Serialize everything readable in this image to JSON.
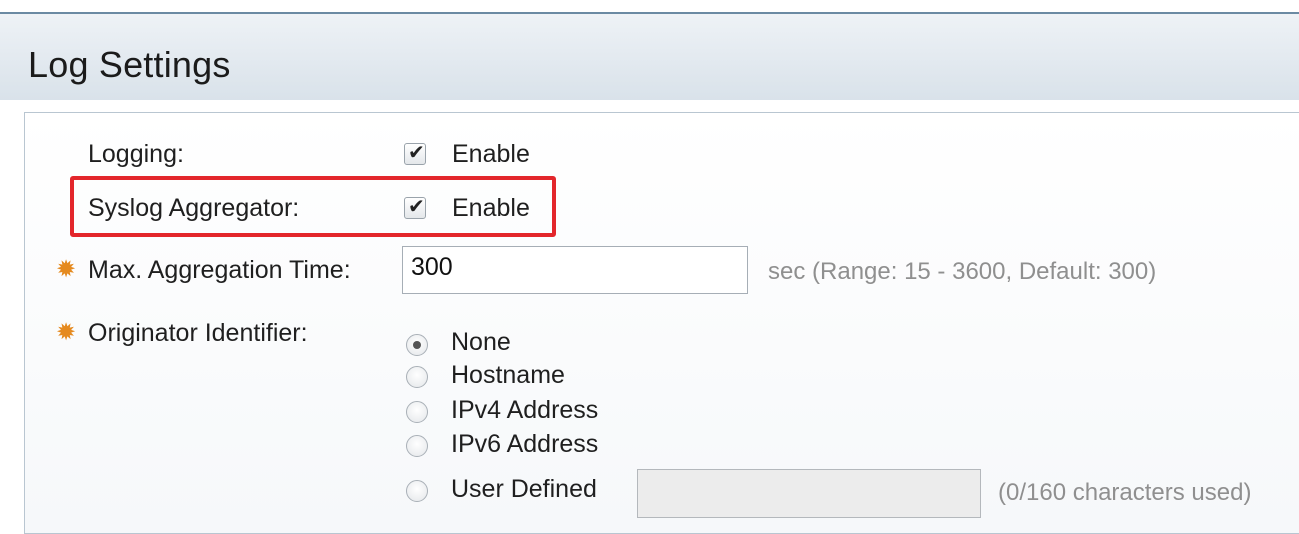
{
  "page": {
    "title": "Log Settings"
  },
  "icons": {
    "required": "required-sun-icon"
  },
  "colors": {
    "highlight": "#e3262b",
    "required_icon": "#e58a1f"
  },
  "form": {
    "logging": {
      "label": "Logging:",
      "checkbox_label": "Enable",
      "checked": true
    },
    "syslog_aggregator": {
      "label": "Syslog Aggregator:",
      "checkbox_label": "Enable",
      "checked": true
    },
    "max_aggregation_time": {
      "label": "Max. Aggregation Time:",
      "value": "300",
      "hint": "sec (Range: 15 - 3600, Default: 300)"
    },
    "originator_identifier": {
      "label": "Originator Identifier:",
      "selected": "None",
      "options": [
        "None",
        "Hostname",
        "IPv4 Address",
        "IPv6 Address",
        "User Defined"
      ],
      "user_defined_value": "",
      "user_defined_hint": "(0/160 characters used)"
    }
  }
}
